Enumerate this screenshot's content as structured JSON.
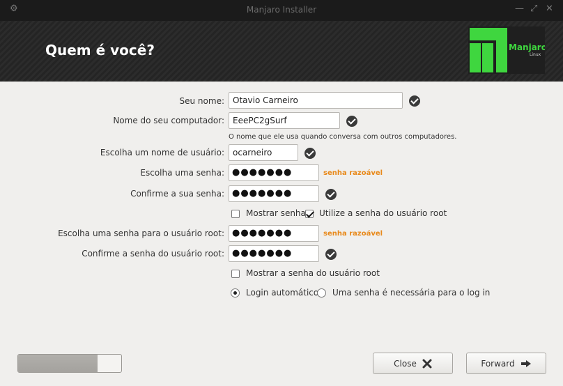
{
  "window": {
    "title": "Manjaro Installer"
  },
  "header": {
    "heading": "Quem é você?",
    "logo_text": "Manjaro",
    "logo_subtext": "Linux",
    "brand_color": "#3fd63f"
  },
  "form": {
    "name": {
      "label": "Seu nome:",
      "value": "Otavio Carneiro"
    },
    "hostname": {
      "label": "Nome do seu computador:",
      "value": "EeePC2gSurf",
      "hint": "O nome que ele usa quando conversa com outros computadores."
    },
    "username": {
      "label": "Escolha um nome de usuário:",
      "value": "ocarneiro"
    },
    "password": {
      "label": "Escolha uma senha:",
      "value": "●●●●●●●",
      "strength": "senha razoável"
    },
    "password_confirm": {
      "label": "Confirme a sua senha:",
      "value": "●●●●●●●"
    },
    "show_password": {
      "label": "Mostrar senha",
      "checked": false
    },
    "use_root": {
      "label": "Utilize a senha do usuário root",
      "checked": true
    },
    "root_password": {
      "label": "Escolha uma senha para o usuário root:",
      "value": "●●●●●●●",
      "strength": "senha razoável"
    },
    "root_password_confirm": {
      "label": "Confirme a senha do usuário root:",
      "value": "●●●●●●●"
    },
    "show_root_password": {
      "label": "Mostrar a senha do usuário root",
      "checked": false
    },
    "login_auto": {
      "label": "Login automático",
      "selected": true
    },
    "login_password": {
      "label": "Uma senha é necessária para o log in",
      "selected": false
    }
  },
  "footer": {
    "progress": 0.77,
    "close_label": "Close",
    "forward_label": "Forward"
  }
}
